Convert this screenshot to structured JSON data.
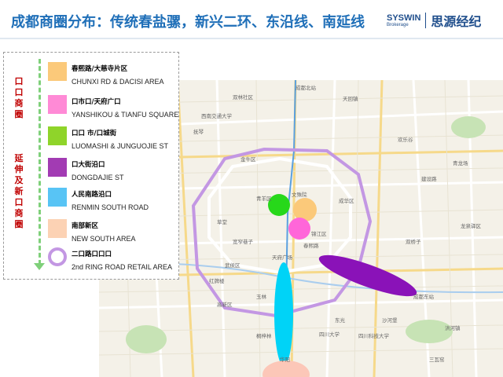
{
  "header": {
    "title": "成都商圈分布：传统春盐骡，新兴二环、东沿线、南延线",
    "logo_en": "SYSWIN",
    "logo_sub": "Brokerage",
    "logo_cn": "思源经纪"
  },
  "side_labels": {
    "traditional": [
      "口",
      "口",
      "商",
      "圈"
    ],
    "extension": [
      "延",
      "伸",
      "及",
      "新",
      "口",
      "商",
      "圈"
    ]
  },
  "legend": [
    {
      "cn": "春熙路/大慈寺片区",
      "en": "CHUNXI RD & DACISI AREA",
      "color": "#fbc97a",
      "shape": "square"
    },
    {
      "cn": "口市口/天府广口",
      "en": "YANSHIKOU & TIANFU SQUARE",
      "color": "#ff8ad6",
      "shape": "square"
    },
    {
      "cn": "口口 市/口城街",
      "en": "LUOMASHI & JUNGUOJIE ST",
      "color": "#8fd42a",
      "shape": "square"
    },
    {
      "cn": "口大街沿口",
      "en": "DONGDAJIE ST",
      "color": "#a23bb3",
      "shape": "square"
    },
    {
      "cn": "人民南路沿口",
      "en": "RENMIN SOUTH ROAD",
      "color": "#58c4f5",
      "shape": "square"
    },
    {
      "cn": "南部新区",
      "en": "NEW SOUTH AREA",
      "color": "#fcd2b4",
      "shape": "square"
    },
    {
      "cn": "二口路口口口",
      "en": "2nd RING ROAD RETAIL AREA",
      "color": "#c397e3",
      "shape": "ring"
    }
  ],
  "map_labels": [
    "成都北站",
    "双林社区",
    "天回镇",
    "西南交通大学",
    "抚琴",
    "金牛区",
    "青羊区",
    "文殊院",
    "成华区",
    "锦江区",
    "武侯区",
    "高新区",
    "玉林",
    "红牌楼",
    "东光",
    "四川大学",
    "双桥子",
    "成都东站",
    "洪河镇",
    "沙河堡",
    "桐梓林",
    "华阳",
    "龙泉驿区",
    "三瓦窑",
    "欢乐谷",
    "青龙场",
    "草堂",
    "宽窄巷子",
    "春熙路",
    "天府广场",
    "四川科技大学",
    "建设路"
  ],
  "colors": {
    "title": "#1f6fb8",
    "side_label": "#c00000",
    "arrow": "#7fd07a",
    "ring": "#c397e3"
  }
}
